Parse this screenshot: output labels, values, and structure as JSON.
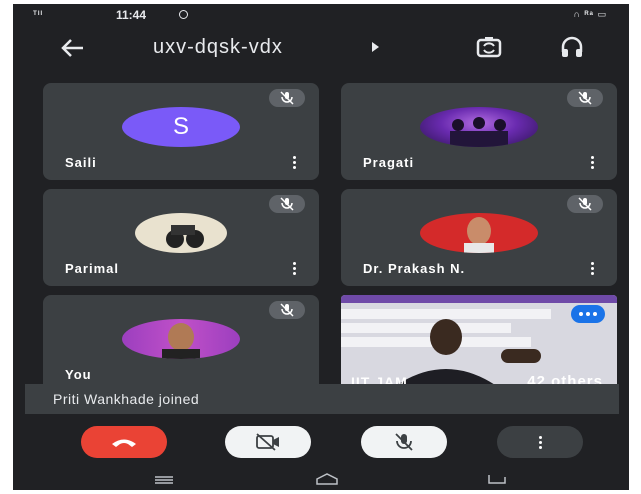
{
  "status_bar": {
    "signal": "ᵀᴵᴵ",
    "time": "11:44",
    "right_icons": "∩ ᴿᵃ ▭"
  },
  "header": {
    "meeting_code": "uxv-dqsk-vdx"
  },
  "participants": [
    {
      "name": "Saili",
      "avatar_letter": "S",
      "muted": true
    },
    {
      "name": "Pragati",
      "muted": true
    },
    {
      "name": "Parimal",
      "muted": true
    },
    {
      "name": "Dr. Prakash N.",
      "muted": true
    },
    {
      "name": "You",
      "muted": true
    }
  ],
  "screen_share": {
    "left_label": "IIT JAM",
    "right_label": "42 others"
  },
  "toast": {
    "text": "Priti Wankhade joined"
  },
  "colors": {
    "background": "#202124",
    "tile": "#3c4043",
    "end_call": "#ea4335",
    "avatar_s": "#7a5af8",
    "accent": "#1a73e8"
  },
  "icons": [
    "back-arrow-icon",
    "switch-camera-icon",
    "headphones-icon",
    "mic-off-icon",
    "more-vert-icon",
    "end-call-icon",
    "camera-off-icon"
  ]
}
